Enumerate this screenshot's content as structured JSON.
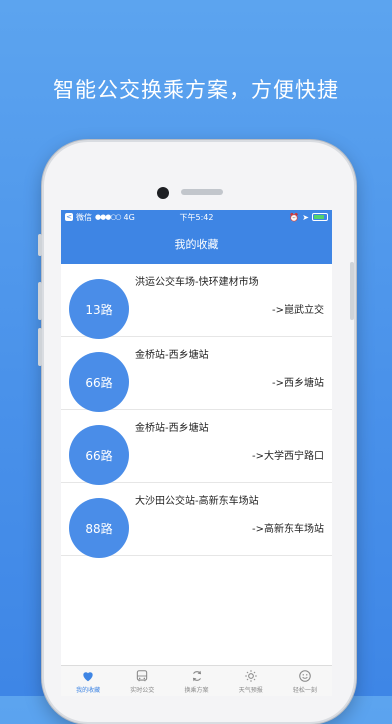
{
  "promo": {
    "headline": "智能公交换乘方案，方便快捷"
  },
  "status_bar": {
    "carrier": "微信",
    "signal": "●●●○○",
    "network": "4G",
    "time": "下午5:42"
  },
  "nav": {
    "title": "我的收藏"
  },
  "favorites": [
    {
      "route": "13路",
      "name": "洪运公交车场-快环建材市场",
      "dest": "->崑武立交"
    },
    {
      "route": "66路",
      "name": "金桥站-西乡塘站",
      "dest": "->西乡塘站"
    },
    {
      "route": "66路",
      "name": "金桥站-西乡塘站",
      "dest": "->大学西宁路口"
    },
    {
      "route": "88路",
      "name": "大沙田公交站-高新东车场站",
      "dest": "->高新东车场站"
    }
  ],
  "tabs": [
    {
      "label": "我的收藏",
      "icon": "heart-icon",
      "active": true
    },
    {
      "label": "实时公交",
      "icon": "bus-icon",
      "active": false
    },
    {
      "label": "换乘方案",
      "icon": "refresh-icon",
      "active": false
    },
    {
      "label": "天气预报",
      "icon": "sun-icon",
      "active": false
    },
    {
      "label": "轻松一刻",
      "icon": "smile-icon",
      "active": false
    }
  ],
  "colors": {
    "accent": "#3e85e4",
    "background": "#4a92ea",
    "route_circle": "#4a8de8"
  }
}
